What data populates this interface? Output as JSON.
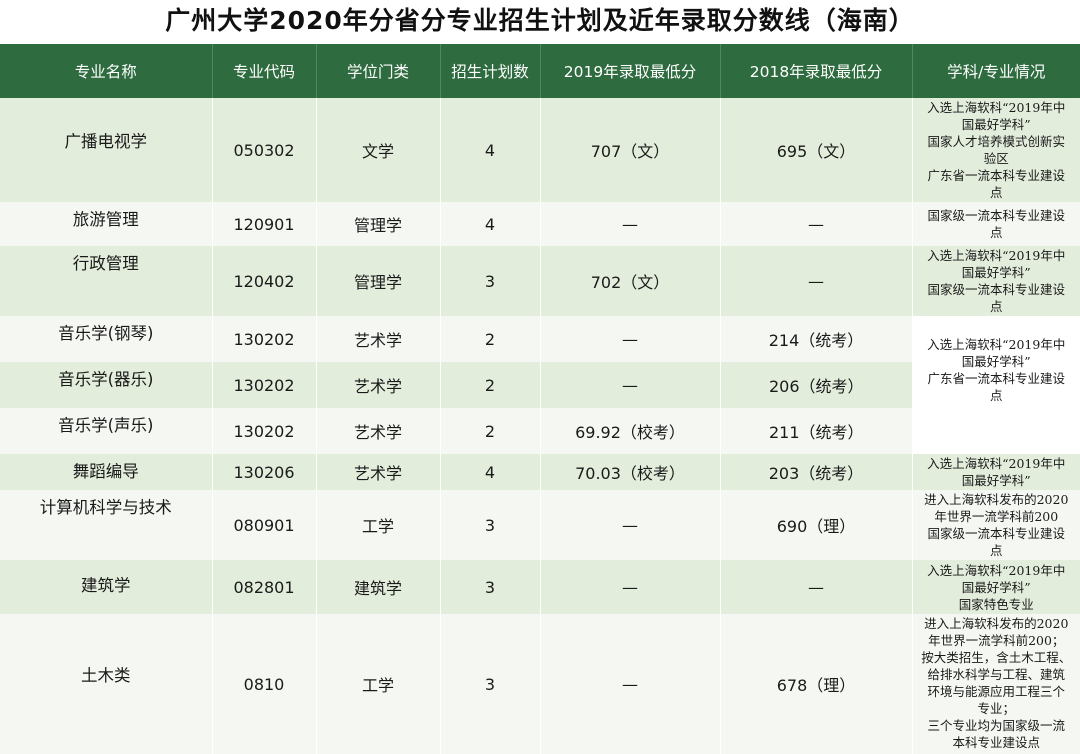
{
  "title": "广州大学2020年分省分专业招生计划及近年录取分数线（海南）",
  "headers": [
    "专业名称",
    "专业代码",
    "学位门类",
    "招生计划数",
    "2019年录取最低分",
    "2018年录取最低分",
    "学科/专业情况"
  ],
  "rows": [
    {
      "name": "广播电视学",
      "code": "050302",
      "degree": "文学",
      "plan": "4",
      "score2019": "707（文）",
      "score2018": "695（文）",
      "note": "入选上海软科“2019年中\n国最好学科”\n国家人才培养模式创新实\n验区\n广东省一流本科专业建设\n点"
    },
    {
      "name": "旅游管理",
      "code": "120901",
      "degree": "管理学",
      "plan": "4",
      "score2019": "—",
      "score2018": "—",
      "note": "国家级一流本科专业建设\n点"
    },
    {
      "name": "行政管理",
      "code": "120402",
      "degree": "管理学",
      "plan": "3",
      "score2019": "702（文）",
      "score2018": "—",
      "note": "入选上海软科“2019年中\n国最好学科”\n国家级一流本科专业建设\n点"
    },
    {
      "name": "音乐学(钢琴)",
      "code": "130202",
      "degree": "艺术学",
      "plan": "2",
      "score2019": "—",
      "score2018": "214（统考）",
      "note": "入选上海软科“2019年中\n国最好学科”\n广东省一流本科专业建设\n点"
    },
    {
      "name": "音乐学(器乐)",
      "code": "130202",
      "degree": "艺术学",
      "plan": "2",
      "score2019": "—",
      "score2018": "206（统考）"
    },
    {
      "name": "音乐学(声乐)",
      "code": "130202",
      "degree": "艺术学",
      "plan": "2",
      "score2019": "69.92（校考）",
      "score2018": "211（统考）"
    },
    {
      "name": "舞蹈编导",
      "code": "130206",
      "degree": "艺术学",
      "plan": "4",
      "score2019": "70.03（校考）",
      "score2018": "203（统考）",
      "note": "入选上海软科“2019年中\n国最好学科”"
    },
    {
      "name": "计算机科学与技术",
      "code": "080901",
      "degree": "工学",
      "plan": "3",
      "score2019": "—",
      "score2018": "690（理）",
      "note": "进入上海软科发布的2020\n年世界一流学科前200\n国家级一流本科专业建设\n点"
    },
    {
      "name": "建筑学",
      "code": "082801",
      "degree": "建筑学",
      "plan": "3",
      "score2019": "—",
      "score2018": "—",
      "note": "入选上海软科“2019年中\n国最好学科”\n国家特色专业"
    },
    {
      "name": "土木类",
      "code": "0810",
      "degree": "工学",
      "plan": "3",
      "score2019": "—",
      "score2018": "678（理）",
      "note": "进入上海软科发布的2020\n年世界一流学科前200；\n按大类招生，含土木工程、\n给排水科学与工程、建筑\n环境与能源应用工程三个\n专业；\n三个专业均为国家级一流\n本科专业建设点"
    }
  ]
}
